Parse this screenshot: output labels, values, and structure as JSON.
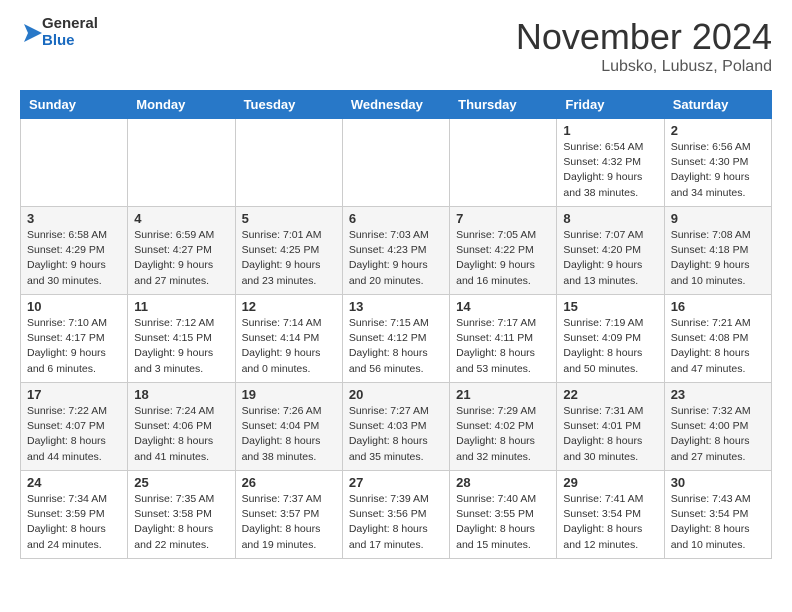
{
  "logo": {
    "line1": "General",
    "line2": "Blue"
  },
  "header": {
    "month": "November 2024",
    "location": "Lubsko, Lubusz, Poland"
  },
  "weekdays": [
    "Sunday",
    "Monday",
    "Tuesday",
    "Wednesday",
    "Thursday",
    "Friday",
    "Saturday"
  ],
  "weeks": [
    [
      {
        "day": "",
        "info": ""
      },
      {
        "day": "",
        "info": ""
      },
      {
        "day": "",
        "info": ""
      },
      {
        "day": "",
        "info": ""
      },
      {
        "day": "",
        "info": ""
      },
      {
        "day": "1",
        "info": "Sunrise: 6:54 AM\nSunset: 4:32 PM\nDaylight: 9 hours\nand 38 minutes."
      },
      {
        "day": "2",
        "info": "Sunrise: 6:56 AM\nSunset: 4:30 PM\nDaylight: 9 hours\nand 34 minutes."
      }
    ],
    [
      {
        "day": "3",
        "info": "Sunrise: 6:58 AM\nSunset: 4:29 PM\nDaylight: 9 hours\nand 30 minutes."
      },
      {
        "day": "4",
        "info": "Sunrise: 6:59 AM\nSunset: 4:27 PM\nDaylight: 9 hours\nand 27 minutes."
      },
      {
        "day": "5",
        "info": "Sunrise: 7:01 AM\nSunset: 4:25 PM\nDaylight: 9 hours\nand 23 minutes."
      },
      {
        "day": "6",
        "info": "Sunrise: 7:03 AM\nSunset: 4:23 PM\nDaylight: 9 hours\nand 20 minutes."
      },
      {
        "day": "7",
        "info": "Sunrise: 7:05 AM\nSunset: 4:22 PM\nDaylight: 9 hours\nand 16 minutes."
      },
      {
        "day": "8",
        "info": "Sunrise: 7:07 AM\nSunset: 4:20 PM\nDaylight: 9 hours\nand 13 minutes."
      },
      {
        "day": "9",
        "info": "Sunrise: 7:08 AM\nSunset: 4:18 PM\nDaylight: 9 hours\nand 10 minutes."
      }
    ],
    [
      {
        "day": "10",
        "info": "Sunrise: 7:10 AM\nSunset: 4:17 PM\nDaylight: 9 hours\nand 6 minutes."
      },
      {
        "day": "11",
        "info": "Sunrise: 7:12 AM\nSunset: 4:15 PM\nDaylight: 9 hours\nand 3 minutes."
      },
      {
        "day": "12",
        "info": "Sunrise: 7:14 AM\nSunset: 4:14 PM\nDaylight: 9 hours\nand 0 minutes."
      },
      {
        "day": "13",
        "info": "Sunrise: 7:15 AM\nSunset: 4:12 PM\nDaylight: 8 hours\nand 56 minutes."
      },
      {
        "day": "14",
        "info": "Sunrise: 7:17 AM\nSunset: 4:11 PM\nDaylight: 8 hours\nand 53 minutes."
      },
      {
        "day": "15",
        "info": "Sunrise: 7:19 AM\nSunset: 4:09 PM\nDaylight: 8 hours\nand 50 minutes."
      },
      {
        "day": "16",
        "info": "Sunrise: 7:21 AM\nSunset: 4:08 PM\nDaylight: 8 hours\nand 47 minutes."
      }
    ],
    [
      {
        "day": "17",
        "info": "Sunrise: 7:22 AM\nSunset: 4:07 PM\nDaylight: 8 hours\nand 44 minutes."
      },
      {
        "day": "18",
        "info": "Sunrise: 7:24 AM\nSunset: 4:06 PM\nDaylight: 8 hours\nand 41 minutes."
      },
      {
        "day": "19",
        "info": "Sunrise: 7:26 AM\nSunset: 4:04 PM\nDaylight: 8 hours\nand 38 minutes."
      },
      {
        "day": "20",
        "info": "Sunrise: 7:27 AM\nSunset: 4:03 PM\nDaylight: 8 hours\nand 35 minutes."
      },
      {
        "day": "21",
        "info": "Sunrise: 7:29 AM\nSunset: 4:02 PM\nDaylight: 8 hours\nand 32 minutes."
      },
      {
        "day": "22",
        "info": "Sunrise: 7:31 AM\nSunset: 4:01 PM\nDaylight: 8 hours\nand 30 minutes."
      },
      {
        "day": "23",
        "info": "Sunrise: 7:32 AM\nSunset: 4:00 PM\nDaylight: 8 hours\nand 27 minutes."
      }
    ],
    [
      {
        "day": "24",
        "info": "Sunrise: 7:34 AM\nSunset: 3:59 PM\nDaylight: 8 hours\nand 24 minutes."
      },
      {
        "day": "25",
        "info": "Sunrise: 7:35 AM\nSunset: 3:58 PM\nDaylight: 8 hours\nand 22 minutes."
      },
      {
        "day": "26",
        "info": "Sunrise: 7:37 AM\nSunset: 3:57 PM\nDaylight: 8 hours\nand 19 minutes."
      },
      {
        "day": "27",
        "info": "Sunrise: 7:39 AM\nSunset: 3:56 PM\nDaylight: 8 hours\nand 17 minutes."
      },
      {
        "day": "28",
        "info": "Sunrise: 7:40 AM\nSunset: 3:55 PM\nDaylight: 8 hours\nand 15 minutes."
      },
      {
        "day": "29",
        "info": "Sunrise: 7:41 AM\nSunset: 3:54 PM\nDaylight: 8 hours\nand 12 minutes."
      },
      {
        "day": "30",
        "info": "Sunrise: 7:43 AM\nSunset: 3:54 PM\nDaylight: 8 hours\nand 10 minutes."
      }
    ]
  ]
}
